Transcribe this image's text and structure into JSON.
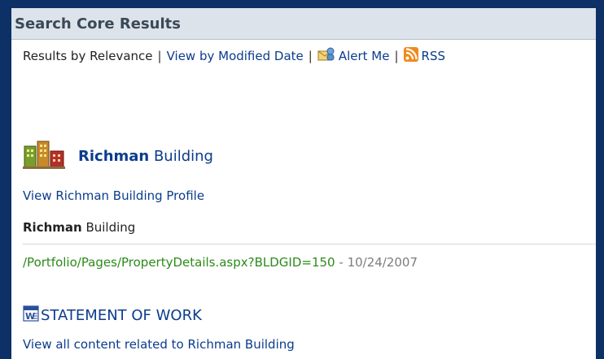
{
  "header": {
    "title": "Search Core Results"
  },
  "toolbar": {
    "relevance_label": "Results by Relevance",
    "separator": "|",
    "modified_date_link": "View by Modified Date",
    "alert_me_link": "Alert Me",
    "rss_link": "RSS"
  },
  "results": [
    {
      "title_bold": "Richman",
      "title_rest": " Building",
      "profile_link": "View Richman Building Profile",
      "desc_bold": "Richman",
      "desc_rest": " Building",
      "url": "/Portfolio/Pages/PropertyDetails.aspx?BLDGID=150",
      "date_sep": " - ",
      "date": "10/24/2007",
      "icon": "building-icon"
    },
    {
      "title": "STATEMENT OF WORK",
      "related_link": "View all content related to Richman Building",
      "icon": "word-document-icon"
    }
  ],
  "colors": {
    "link": "#0b3c8c",
    "url": "#2c8a1a",
    "date": "#7c7c7c",
    "header_bg": "#dde3ea"
  }
}
